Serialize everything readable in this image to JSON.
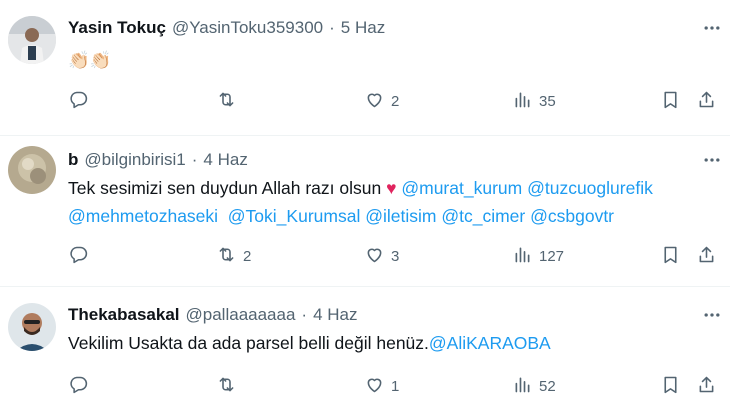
{
  "tweets": [
    {
      "name": "Yasin Tokuç",
      "handle": "@YasinToku359300",
      "dot": "·",
      "date": "5 Haz",
      "text_parts": [
        {
          "text": "👏🏻👏🏻",
          "type": "emoji"
        }
      ],
      "reply_count": "",
      "retweet_count": "",
      "like_count": "2",
      "view_count": "35"
    },
    {
      "name": "b",
      "handle": "@bilginbirisi1",
      "dot": "·",
      "date": "4 Haz",
      "line1": "Tek sesimizi sen duydun Allah razı olsun",
      "heart": "♥",
      "mentions1": [
        "@murat_kurum",
        "@tuzcuoglurefik"
      ],
      "mentions2": [
        "@mehmetozhaseki",
        "@Toki_Kurumsal",
        "@iletisim",
        "@tc_cimer",
        "@csbgovtr"
      ],
      "reply_count": "",
      "retweet_count": "2",
      "like_count": "3",
      "view_count": "127"
    },
    {
      "name": "Thekabasakal",
      "handle": "@pallaaaaaaa",
      "dot": "·",
      "date": "4 Haz",
      "text": "Vekilim Usakta da ada parsel belli değil henüz.",
      "mention": "@AliKARAOBA",
      "reply_count": "",
      "retweet_count": "",
      "like_count": "1",
      "view_count": "52"
    }
  ],
  "icons": {
    "reply": "reply-icon",
    "retweet": "retweet-icon",
    "like": "heart-icon",
    "views": "views-icon",
    "bookmark": "bookmark-icon",
    "share": "share-icon",
    "more": "more-icon"
  },
  "colors": {
    "text": "#0f1419",
    "secondary": "#536471",
    "link": "#1d9bf0",
    "divider": "#eff3f4",
    "heart_emoji": "#e0245e"
  }
}
